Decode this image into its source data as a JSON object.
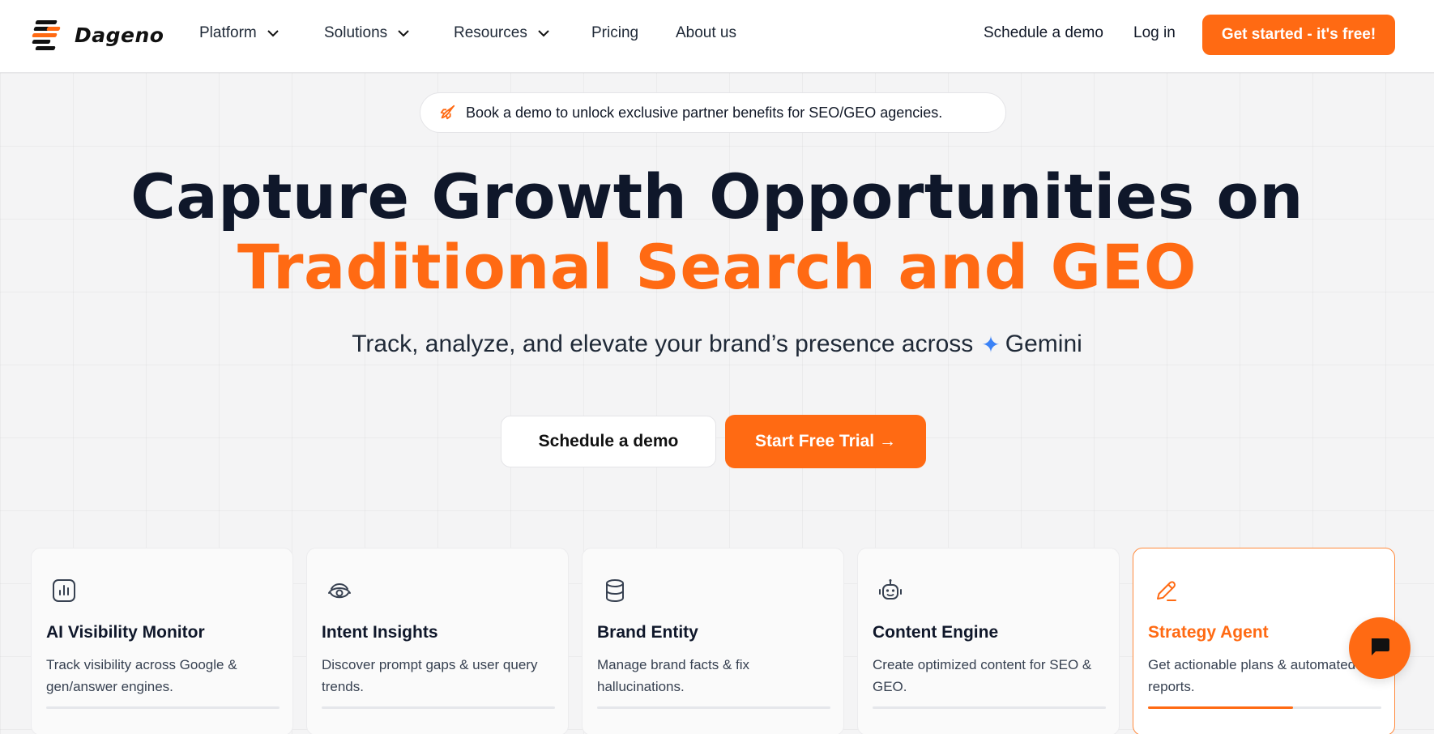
{
  "brand": {
    "name": "Dageno",
    "accent": "#ff6a13",
    "logo_icon": "dageno-logo-icon"
  },
  "nav": {
    "items": [
      {
        "label": "Platform",
        "has_dropdown": true
      },
      {
        "label": "Solutions",
        "has_dropdown": true
      },
      {
        "label": "Resources",
        "has_dropdown": true
      },
      {
        "label": "Pricing",
        "has_dropdown": false
      },
      {
        "label": "About us",
        "has_dropdown": false
      }
    ],
    "schedule_demo": "Schedule a demo",
    "login": "Log in",
    "cta": "Get started - it's free!"
  },
  "announcement": {
    "icon": "rocket-icon",
    "text": "Book a demo to unlock exclusive partner benefits for SEO/GEO agencies."
  },
  "hero": {
    "headline_line1": "Capture Growth Opportunities on",
    "headline_line2": "Traditional Search and GEO",
    "subtitle": "Track, analyze, and elevate your brand’s presence across",
    "subtitle_engine_icon": "gemini-sparkle-icon",
    "subtitle_engine": "Gemini",
    "btn_demo": "Schedule a demo",
    "btn_trial": "Start Free Trial →"
  },
  "features": [
    {
      "icon": "bar-chart-icon",
      "title": "AI Visibility Monitor",
      "desc": "Track visibility across Google & gen/answer engines.",
      "active": false,
      "progress": 0
    },
    {
      "icon": "eye-icon",
      "title": "Intent Insights",
      "desc": "Discover prompt gaps & user query trends.",
      "active": false,
      "progress": 0
    },
    {
      "icon": "database-icon",
      "title": "Brand Entity",
      "desc": "Manage brand facts & fix hallucinations.",
      "active": false,
      "progress": 0
    },
    {
      "icon": "robot-icon",
      "title": "Content Engine",
      "desc": "Create optimized content for SEO & GEO.",
      "active": false,
      "progress": 0
    },
    {
      "icon": "pencil-icon",
      "title": "Strategy Agent",
      "desc": "Get actionable plans & automated reports.",
      "active": true,
      "progress": 0.62
    }
  ],
  "chat_widget": {
    "icon": "chat-bubble-icon"
  }
}
